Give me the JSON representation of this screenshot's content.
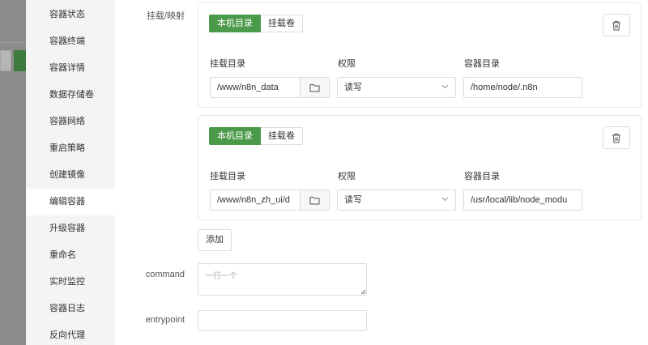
{
  "sidebar": {
    "items": [
      {
        "label": "容器状态"
      },
      {
        "label": "容器终端"
      },
      {
        "label": "容器详情"
      },
      {
        "label": "数据存储卷"
      },
      {
        "label": "容器网络"
      },
      {
        "label": "重启策略"
      },
      {
        "label": "创建镜像"
      },
      {
        "label": "编辑容器",
        "active": true
      },
      {
        "label": "升级容器"
      },
      {
        "label": "重命名"
      },
      {
        "label": "实时监控"
      },
      {
        "label": "容器日志"
      },
      {
        "label": "反向代理"
      }
    ]
  },
  "form": {
    "mount_label": "挂载/映射",
    "mount_type_local": "本机目录",
    "mount_type_volume": "挂载卷",
    "col_mount_dir": "挂载目录",
    "col_permission": "权限",
    "col_container_dir": "容器目录",
    "mounts": [
      {
        "host_dir": "/www/n8n_data",
        "permission": "读写",
        "container_dir": "/home/node/.n8n"
      },
      {
        "host_dir": "/www/n8n_zh_ui/d",
        "permission": "读写",
        "container_dir": "/usr/local/lib/node_modu"
      }
    ],
    "add_label": "添加",
    "command_label": "command",
    "command_placeholder": "一行一个",
    "entrypoint_label": "entrypoint",
    "entrypoint_value": ""
  },
  "colors": {
    "accent": "#4a9a4a",
    "sidebar_bg": "#f4f4f4",
    "border": "#dcdcdc"
  },
  "icons": {
    "delete": "trash-icon",
    "folder": "folder-icon",
    "select": "chevron-down-icon",
    "grip": "resize-grip-icon"
  }
}
